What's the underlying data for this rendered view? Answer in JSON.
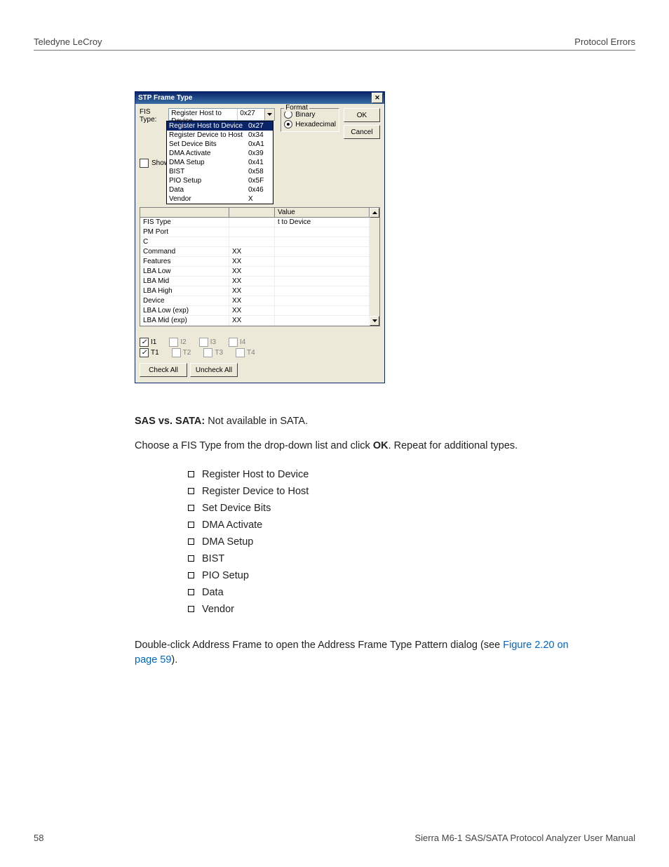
{
  "header": {
    "left": "Teledyne LeCroy",
    "right": "Protocol Errors"
  },
  "dialog": {
    "title": "STP Frame Type",
    "fis_label": "FIS Type:",
    "combo": {
      "text": "Register Host to Device",
      "code": "0x27"
    },
    "options": [
      {
        "name": "Register Host to Device",
        "code": "0x27",
        "sel": true
      },
      {
        "name": "Register Device to Host",
        "code": "0x34"
      },
      {
        "name": "Set Device Bits",
        "code": "0xA1"
      },
      {
        "name": "DMA Activate",
        "code": "0x39"
      },
      {
        "name": "DMA Setup",
        "code": "0x41"
      },
      {
        "name": "BIST",
        "code": "0x58"
      },
      {
        "name": "PIO Setup",
        "code": "0x5F"
      },
      {
        "name": "Data",
        "code": "0x46"
      },
      {
        "name": "Vendor",
        "code": "X"
      }
    ],
    "show_label": "Show R",
    "format": {
      "legend": "Format",
      "binary": "Binary",
      "hex": "Hexadecimal"
    },
    "ok": "OK",
    "cancel": "Cancel",
    "grid_headers": {
      "name": "",
      "mask": "",
      "value": "Value"
    },
    "grid_rows": [
      {
        "a": "FIS Type",
        "b": "",
        "c": "t to Device"
      },
      {
        "a": "PM Port",
        "b": "",
        "c": ""
      },
      {
        "a": "C",
        "b": "",
        "c": ""
      },
      {
        "a": "Command",
        "b": "XX",
        "c": ""
      },
      {
        "a": "Features",
        "b": "XX",
        "c": ""
      },
      {
        "a": "LBA Low",
        "b": "XX",
        "c": ""
      },
      {
        "a": "LBA Mid",
        "b": "XX",
        "c": ""
      },
      {
        "a": "LBA High",
        "b": "XX",
        "c": ""
      },
      {
        "a": "Device",
        "b": "XX",
        "c": ""
      },
      {
        "a": "LBA Low (exp)",
        "b": "XX",
        "c": ""
      },
      {
        "a": "LBA Mid (exp)",
        "b": "XX",
        "c": ""
      }
    ],
    "checks_i": [
      "I1",
      "I2",
      "I3",
      "I4"
    ],
    "checks_t": [
      "T1",
      "T2",
      "T3",
      "T4"
    ],
    "check_all": "Check All",
    "uncheck_all": "Uncheck All"
  },
  "body": {
    "sas_label": "SAS vs. SATA:",
    "sas_text": " Not available in SATA.",
    "choose_pre": "Choose a FIS Type from the drop-down list and click ",
    "choose_ok": "OK",
    "choose_post": ". Repeat for additional types.",
    "list": [
      "Register Host to Device",
      "Register Device to Host",
      "Set Device Bits",
      "DMA Activate",
      "DMA Setup",
      "BIST",
      "PIO Setup",
      "Data",
      "Vendor"
    ],
    "dbl_pre": "Double-click Address Frame to open the Address Frame Type Pattern dialog (see ",
    "dbl_link": "Figure 2.20 on page 59",
    "dbl_post": ")."
  },
  "footer": {
    "page": "58",
    "manual": "Sierra M6-1 SAS/SATA Protocol Analyzer User Manual"
  }
}
